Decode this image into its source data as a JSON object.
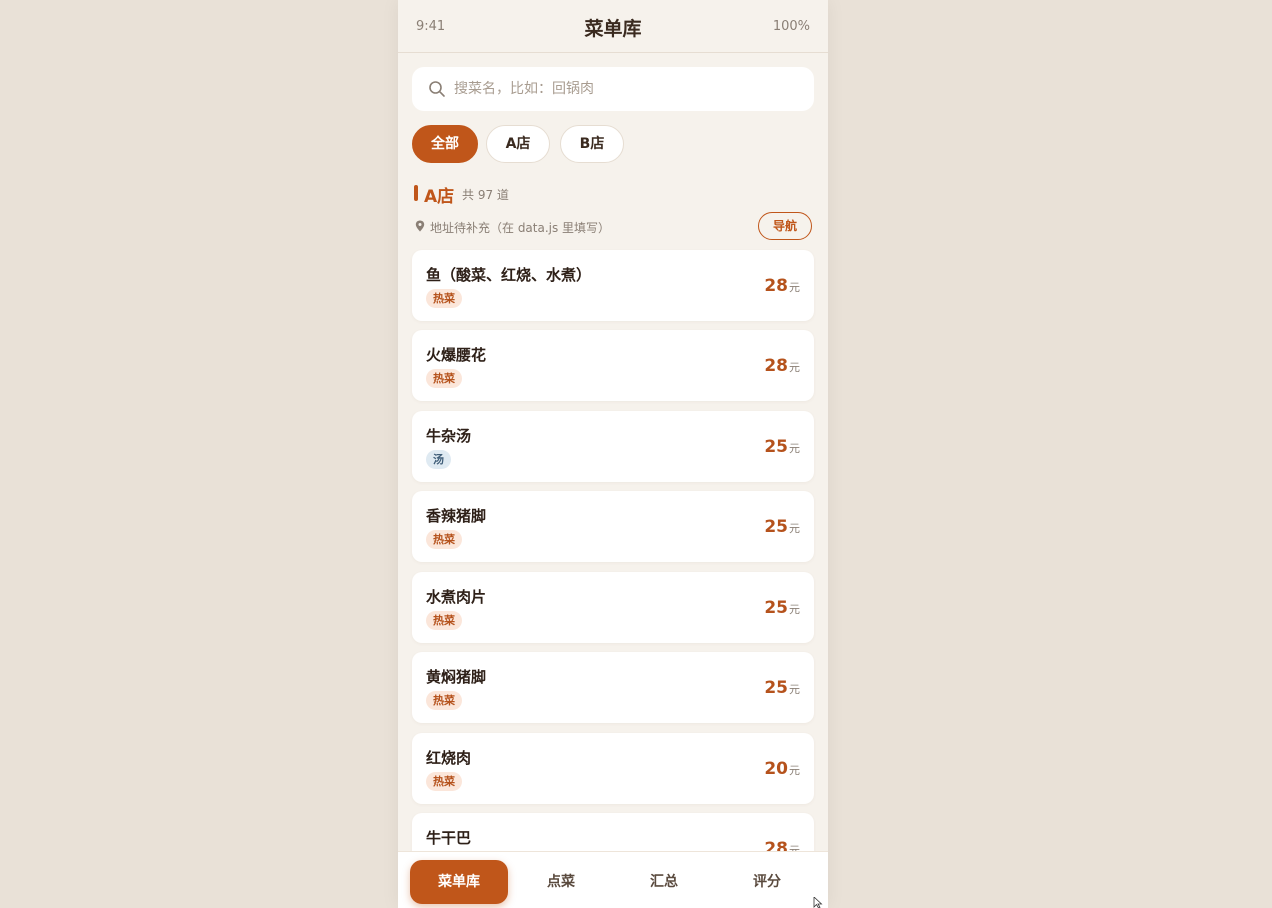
{
  "status": {
    "time": "9:41",
    "title": "菜单库",
    "battery": "100%"
  },
  "search": {
    "placeholder": "搜菜名，比如：回锅肉",
    "value": ""
  },
  "tabs": [
    {
      "label": "全部",
      "active": true
    },
    {
      "label": "A店",
      "active": false
    },
    {
      "label": "B店",
      "active": false
    }
  ],
  "section": {
    "title": "A店",
    "count": "共 97 道",
    "address": "地址待补充（在 data.js 里填写）",
    "nav_label": "导航"
  },
  "dishes": [
    {
      "name": "鱼（酸菜、红烧、水煮）",
      "tag": "热菜",
      "tag_type": "hot",
      "price": "28",
      "unit": "元"
    },
    {
      "name": "火爆腰花",
      "tag": "热菜",
      "tag_type": "hot",
      "price": "28",
      "unit": "元"
    },
    {
      "name": "牛杂汤",
      "tag": "汤",
      "tag_type": "soup",
      "price": "25",
      "unit": "元"
    },
    {
      "name": "香辣猪脚",
      "tag": "热菜",
      "tag_type": "hot",
      "price": "25",
      "unit": "元"
    },
    {
      "name": "水煮肉片",
      "tag": "热菜",
      "tag_type": "hot",
      "price": "25",
      "unit": "元"
    },
    {
      "name": "黄焖猪脚",
      "tag": "热菜",
      "tag_type": "hot",
      "price": "25",
      "unit": "元"
    },
    {
      "name": "红烧肉",
      "tag": "热菜",
      "tag_type": "hot",
      "price": "20",
      "unit": "元"
    },
    {
      "name": "牛干巴",
      "tag": "",
      "tag_type": "hot",
      "price": "28",
      "unit": "元"
    }
  ],
  "bottom_nav": [
    {
      "label": "菜单库",
      "active": true
    },
    {
      "label": "点菜",
      "active": false
    },
    {
      "label": "汇总",
      "active": false
    },
    {
      "label": "评分",
      "active": false
    }
  ],
  "colors": {
    "accent": "#c0561a",
    "background": "#e9e1d7",
    "panel": "#f6f2ec"
  }
}
